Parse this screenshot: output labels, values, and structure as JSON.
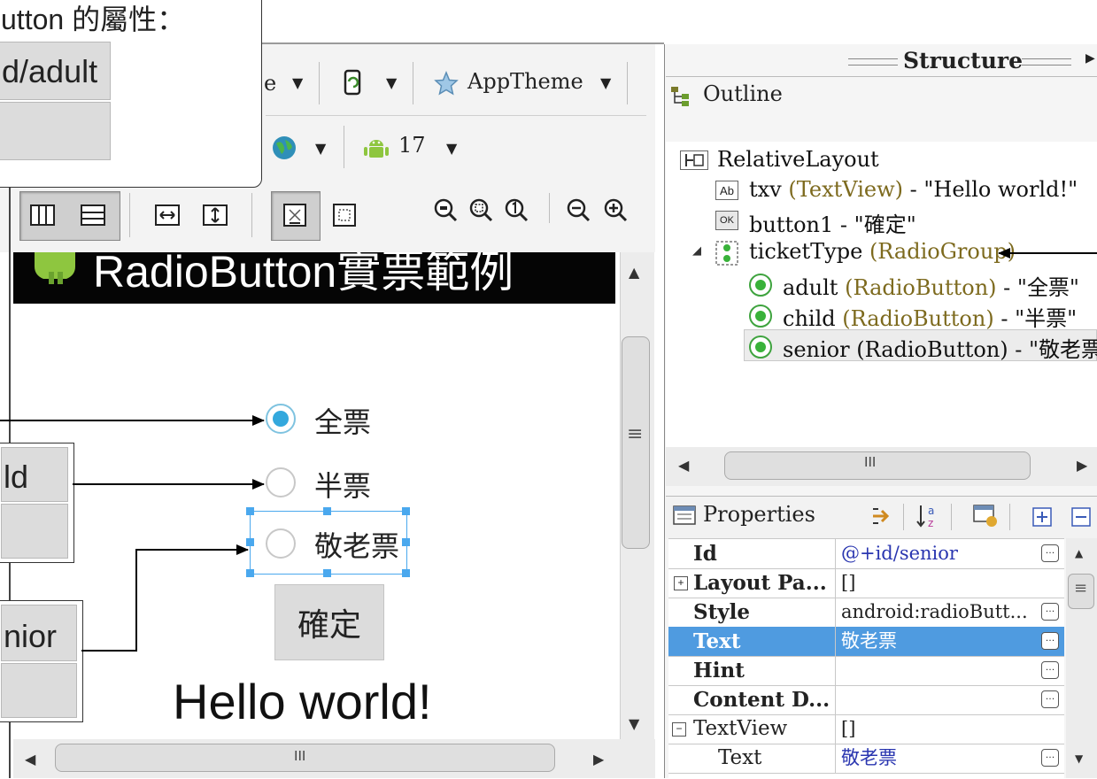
{
  "top_callout": {
    "caption": "utton 的屬性：",
    "cell_value": "d/adult"
  },
  "toolbar": {
    "row1": {
      "truncated_text": "e",
      "theme_label": "AppTheme"
    },
    "row2": {
      "api_level": "17"
    }
  },
  "device": {
    "app_title": "RadioButton實票範例",
    "radios": [
      {
        "label": "全票",
        "checked": true
      },
      {
        "label": "半票",
        "checked": false
      },
      {
        "label": "敬老票",
        "checked": false
      }
    ],
    "button_label": "確定",
    "hello_text": "Hello world!"
  },
  "left_callouts": {
    "child_cell": "ld",
    "senior_cell": "nior"
  },
  "scroll": {
    "grip": "III",
    "vgrip": "≡"
  },
  "structure": {
    "panel_title": "Structure",
    "outline_title": "Outline",
    "tree": [
      {
        "id": "root",
        "name": "RelativeLayout",
        "type": "",
        "text": ""
      },
      {
        "id": "txv",
        "name": "txv",
        "type": "(TextView)",
        "text": " - \"Hello world!\""
      },
      {
        "id": "button1",
        "name": "button1",
        "type": "",
        "text": " - \"確定\""
      },
      {
        "id": "ticketType",
        "name": "ticketType",
        "type": "(RadioGroup)",
        "text": ""
      },
      {
        "id": "adult",
        "name": "adult",
        "type": "(RadioButton)",
        "text": " - \"全票\""
      },
      {
        "id": "child",
        "name": "child",
        "type": "(RadioButton)",
        "text": " - \"半票\""
      },
      {
        "id": "senior",
        "name": "senior",
        "type": "(RadioButton)",
        "text": " - \"敬老票"
      }
    ],
    "icons": {
      "txv": "Ab",
      "button1": "OK"
    }
  },
  "properties": {
    "title": "Properties",
    "rows": [
      {
        "name": "Id",
        "value": "@+id/senior"
      },
      {
        "name": "Layout Pa...",
        "value": "[]"
      },
      {
        "name": "Style",
        "value": "android:radioButt..."
      },
      {
        "name": "Text",
        "value": "敬老票"
      },
      {
        "name": "Hint",
        "value": ""
      },
      {
        "name": "Content D...",
        "value": ""
      },
      {
        "name": "TextView",
        "value": "[]"
      },
      {
        "name": "Text",
        "value": "敬老票"
      }
    ],
    "expanders": [
      "+",
      "−"
    ],
    "ellipsis": "…"
  }
}
